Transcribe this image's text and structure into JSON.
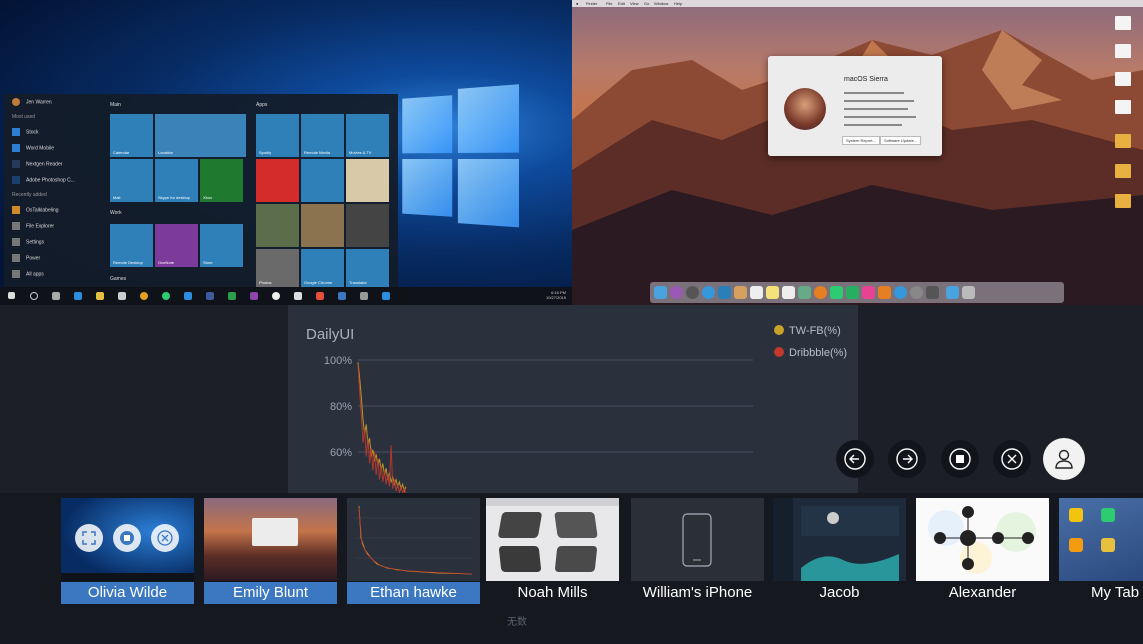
{
  "windows_screen": {
    "user": "Jen Warren",
    "most_used_header": "Most used",
    "most_used": [
      "Stock",
      "Word Mobile",
      "Nextgen Reader",
      "Adobe Photoshop C..."
    ],
    "recently_added_header": "Recently added",
    "recently_added": [
      "OsTalklabeling"
    ],
    "system_items": [
      "File Explorer",
      "Settings",
      "Power",
      "All apps"
    ],
    "groups": [
      "Main",
      "Apps",
      "Work",
      "Games"
    ],
    "tiles": [
      "Calendar",
      "Location",
      "Spotify",
      "Remote Media",
      "Movies & TV",
      "Mail",
      "Skype for desktop",
      "Xbox",
      "Remote Desktop",
      "OneNote",
      "Store",
      "Photos",
      "Google Chrome",
      "Translator"
    ],
    "clock_time": "6:18 PM",
    "clock_date": "10/27/2015"
  },
  "mac_screen": {
    "menubar": [
      "Finder",
      "File",
      "Edit",
      "View",
      "Go",
      "Window",
      "Help"
    ],
    "about_title": "macOS Sierra",
    "about_buttons": [
      "System Report...",
      "Software Update..."
    ]
  },
  "chart_data": {
    "type": "line",
    "title": "DailyUI",
    "yticks": [
      "100%",
      "80%",
      "60%"
    ],
    "ylim": [
      40,
      100
    ],
    "grid": true,
    "legend_position": "top-right",
    "series": [
      {
        "name": "TW-FB(%)",
        "color": "#c9a227",
        "values": [
          99,
          92,
          84,
          74,
          68,
          72,
          63,
          66,
          58,
          61,
          56,
          59,
          54,
          57,
          52,
          55,
          50,
          53,
          48,
          51,
          47,
          49,
          46,
          48,
          45,
          47,
          44,
          46,
          43,
          45
        ]
      },
      {
        "name": "Dribbble(%)",
        "color": "#c0392b",
        "values": [
          98,
          86,
          76,
          64,
          70,
          58,
          66,
          55,
          62,
          52,
          60,
          50,
          57,
          48,
          54,
          47,
          52,
          46,
          50,
          45,
          63,
          44,
          48,
          43,
          46,
          42,
          45,
          42,
          44,
          41
        ]
      }
    ]
  },
  "controls": {
    "back_icon": "arrow-left-icon",
    "forward_icon": "arrow-right-icon",
    "stop_icon": "stop-icon",
    "close_icon": "close-icon",
    "profile_icon": "person-icon"
  },
  "devices": [
    {
      "name": "Olivia Wilde",
      "selected": true
    },
    {
      "name": "Emily Blunt",
      "selected": true
    },
    {
      "name": "Ethan hawke",
      "selected": true
    },
    {
      "name": "Noah Mills",
      "selected": false
    },
    {
      "name": "William's iPhone",
      "selected": false
    },
    {
      "name": "Jacob",
      "selected": false
    },
    {
      "name": "Alexander",
      "selected": false
    },
    {
      "name": "My Tab",
      "selected": false
    }
  ],
  "ghost_text": "无数"
}
